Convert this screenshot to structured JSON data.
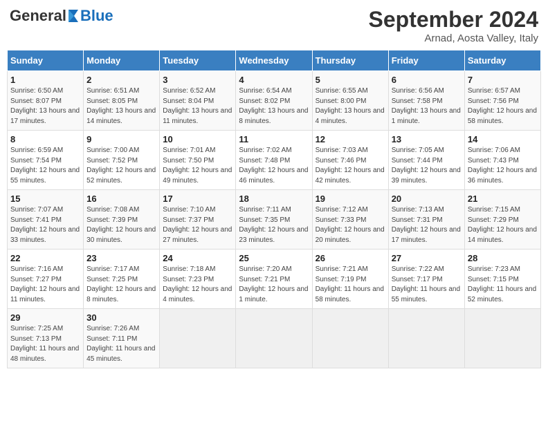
{
  "logo": {
    "general": "General",
    "blue": "Blue"
  },
  "title": "September 2024",
  "subtitle": "Arnad, Aosta Valley, Italy",
  "days": [
    "Sunday",
    "Monday",
    "Tuesday",
    "Wednesday",
    "Thursday",
    "Friday",
    "Saturday"
  ],
  "weeks": [
    [
      {
        "day": "1",
        "sunrise": "6:50 AM",
        "sunset": "8:07 PM",
        "daylight": "13 hours and 17 minutes."
      },
      {
        "day": "2",
        "sunrise": "6:51 AM",
        "sunset": "8:05 PM",
        "daylight": "13 hours and 14 minutes."
      },
      {
        "day": "3",
        "sunrise": "6:52 AM",
        "sunset": "8:04 PM",
        "daylight": "13 hours and 11 minutes."
      },
      {
        "day": "4",
        "sunrise": "6:54 AM",
        "sunset": "8:02 PM",
        "daylight": "13 hours and 8 minutes."
      },
      {
        "day": "5",
        "sunrise": "6:55 AM",
        "sunset": "8:00 PM",
        "daylight": "13 hours and 4 minutes."
      },
      {
        "day": "6",
        "sunrise": "6:56 AM",
        "sunset": "7:58 PM",
        "daylight": "13 hours and 1 minute."
      },
      {
        "day": "7",
        "sunrise": "6:57 AM",
        "sunset": "7:56 PM",
        "daylight": "12 hours and 58 minutes."
      }
    ],
    [
      {
        "day": "8",
        "sunrise": "6:59 AM",
        "sunset": "7:54 PM",
        "daylight": "12 hours and 55 minutes."
      },
      {
        "day": "9",
        "sunrise": "7:00 AM",
        "sunset": "7:52 PM",
        "daylight": "12 hours and 52 minutes."
      },
      {
        "day": "10",
        "sunrise": "7:01 AM",
        "sunset": "7:50 PM",
        "daylight": "12 hours and 49 minutes."
      },
      {
        "day": "11",
        "sunrise": "7:02 AM",
        "sunset": "7:48 PM",
        "daylight": "12 hours and 46 minutes."
      },
      {
        "day": "12",
        "sunrise": "7:03 AM",
        "sunset": "7:46 PM",
        "daylight": "12 hours and 42 minutes."
      },
      {
        "day": "13",
        "sunrise": "7:05 AM",
        "sunset": "7:44 PM",
        "daylight": "12 hours and 39 minutes."
      },
      {
        "day": "14",
        "sunrise": "7:06 AM",
        "sunset": "7:43 PM",
        "daylight": "12 hours and 36 minutes."
      }
    ],
    [
      {
        "day": "15",
        "sunrise": "7:07 AM",
        "sunset": "7:41 PM",
        "daylight": "12 hours and 33 minutes."
      },
      {
        "day": "16",
        "sunrise": "7:08 AM",
        "sunset": "7:39 PM",
        "daylight": "12 hours and 30 minutes."
      },
      {
        "day": "17",
        "sunrise": "7:10 AM",
        "sunset": "7:37 PM",
        "daylight": "12 hours and 27 minutes."
      },
      {
        "day": "18",
        "sunrise": "7:11 AM",
        "sunset": "7:35 PM",
        "daylight": "12 hours and 23 minutes."
      },
      {
        "day": "19",
        "sunrise": "7:12 AM",
        "sunset": "7:33 PM",
        "daylight": "12 hours and 20 minutes."
      },
      {
        "day": "20",
        "sunrise": "7:13 AM",
        "sunset": "7:31 PM",
        "daylight": "12 hours and 17 minutes."
      },
      {
        "day": "21",
        "sunrise": "7:15 AM",
        "sunset": "7:29 PM",
        "daylight": "12 hours and 14 minutes."
      }
    ],
    [
      {
        "day": "22",
        "sunrise": "7:16 AM",
        "sunset": "7:27 PM",
        "daylight": "12 hours and 11 minutes."
      },
      {
        "day": "23",
        "sunrise": "7:17 AM",
        "sunset": "7:25 PM",
        "daylight": "12 hours and 8 minutes."
      },
      {
        "day": "24",
        "sunrise": "7:18 AM",
        "sunset": "7:23 PM",
        "daylight": "12 hours and 4 minutes."
      },
      {
        "day": "25",
        "sunrise": "7:20 AM",
        "sunset": "7:21 PM",
        "daylight": "12 hours and 1 minute."
      },
      {
        "day": "26",
        "sunrise": "7:21 AM",
        "sunset": "7:19 PM",
        "daylight": "11 hours and 58 minutes."
      },
      {
        "day": "27",
        "sunrise": "7:22 AM",
        "sunset": "7:17 PM",
        "daylight": "11 hours and 55 minutes."
      },
      {
        "day": "28",
        "sunrise": "7:23 AM",
        "sunset": "7:15 PM",
        "daylight": "11 hours and 52 minutes."
      }
    ],
    [
      {
        "day": "29",
        "sunrise": "7:25 AM",
        "sunset": "7:13 PM",
        "daylight": "11 hours and 48 minutes."
      },
      {
        "day": "30",
        "sunrise": "7:26 AM",
        "sunset": "7:11 PM",
        "daylight": "11 hours and 45 minutes."
      },
      null,
      null,
      null,
      null,
      null
    ]
  ]
}
